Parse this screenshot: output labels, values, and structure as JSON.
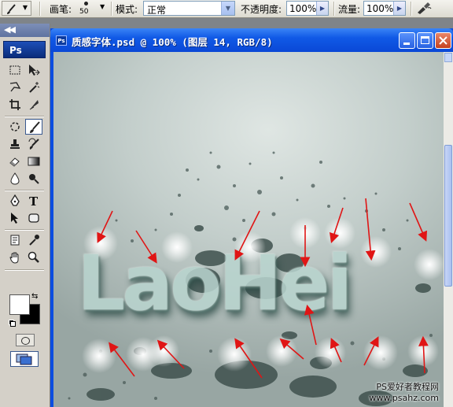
{
  "options_bar": {
    "brush_label": "画笔:",
    "brush_size": "50",
    "mode_label": "模式:",
    "mode_value": "正常",
    "opacity_label": "不透明度:",
    "opacity_value": "100%",
    "flow_label": "流量:",
    "flow_value": "100%"
  },
  "toolbox": {
    "logo": "Ps",
    "foreground_color": "#ffffff",
    "background_color": "#000000"
  },
  "document": {
    "title": "质感字体.psd @ 100% (图层 14, RGB/8)",
    "icon_label": "Ps",
    "artwork_text": "LaoHei",
    "arrow_color": "#e01515"
  },
  "watermark": {
    "line1": "PS爱好者教程网",
    "line2": "www.psahz.com"
  },
  "colors": {
    "titlebar": "#0a48d6",
    "canvas_bg": "#c3cecb"
  }
}
